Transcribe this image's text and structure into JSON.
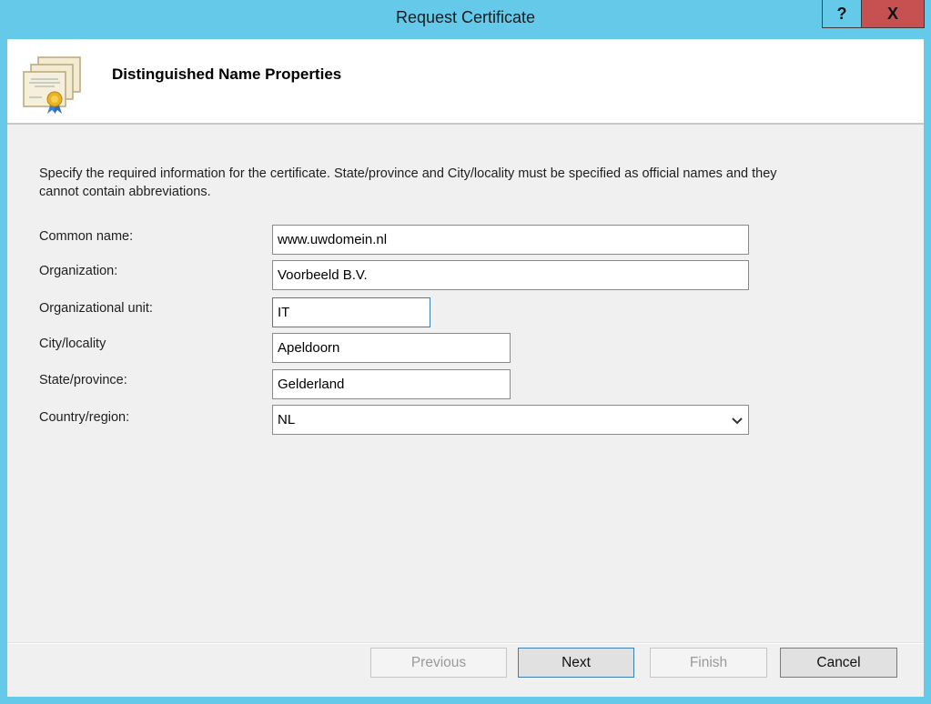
{
  "window": {
    "title": "Request Certificate",
    "help_label": "?",
    "close_label": "X"
  },
  "header": {
    "title": "Distinguished Name Properties",
    "icon": "certificate-icon"
  },
  "description": "Specify the required information for the certificate. State/province and City/locality must be specified as official names and they cannot contain abbreviations.",
  "form": {
    "fields": [
      {
        "label": "Common name:",
        "value": "www.uwdomein.nl"
      },
      {
        "label": "Organization:",
        "value": "Voorbeeld B.V."
      },
      {
        "label": "Organizational unit:",
        "value": "IT"
      },
      {
        "label": "City/locality",
        "value": "Apeldoorn"
      },
      {
        "label": "State/province:",
        "value": "Gelderland"
      },
      {
        "label": "Country/region:",
        "value": "NL"
      }
    ]
  },
  "buttons": {
    "previous": "Previous",
    "next": "Next",
    "finish": "Finish",
    "cancel": "Cancel"
  }
}
